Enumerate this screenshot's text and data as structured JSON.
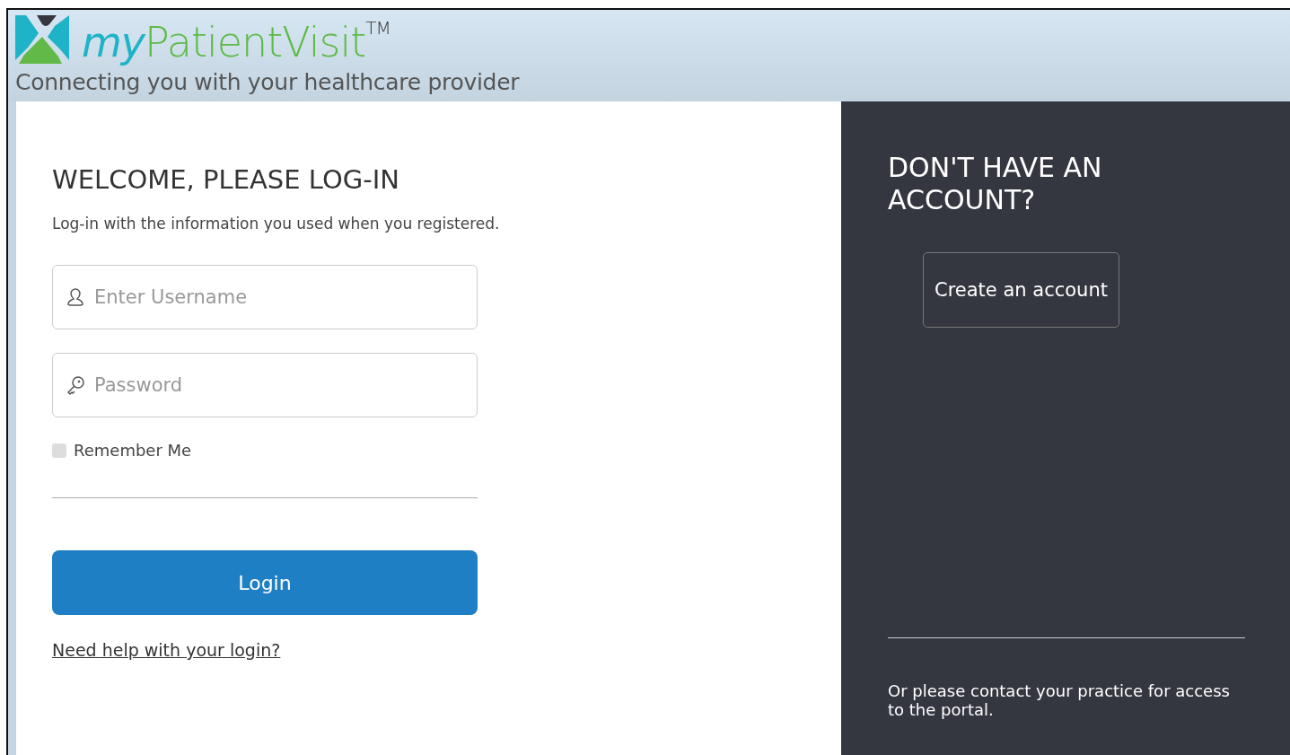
{
  "header": {
    "logo_prefix": "my",
    "logo_name": "PatientVisit",
    "logo_mark": "TM",
    "tagline": "Connecting you with your healthcare provider"
  },
  "login": {
    "title": "WELCOME, PLEASE LOG-IN",
    "subtitle": "Log-in with the information you used when you registered.",
    "username": {
      "placeholder": "Enter Username"
    },
    "password": {
      "placeholder": "Password"
    },
    "remember": {
      "label": "Remember Me",
      "checked": false
    },
    "button": "Login",
    "help_link": "Need help with your login?"
  },
  "signup": {
    "title": "DON'T HAVE AN ACCOUNT?",
    "button": "Create an account",
    "note": "Or please contact your practice for access to the portal."
  }
}
